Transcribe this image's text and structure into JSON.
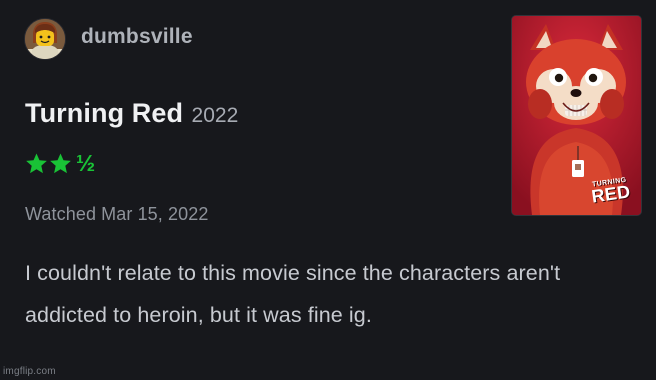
{
  "review": {
    "username": "dumbsville",
    "movie_title": "Turning Red",
    "year": "2022",
    "rating": {
      "stars": 2.5,
      "max": 5,
      "star_glyphs": "★★",
      "half_glyph": "½",
      "color": "#19c236"
    },
    "watched_date": "Watched Mar 15, 2022",
    "text": "I couldn't relate to this movie since the characters aren't addicted to heroin, but it was fine ig."
  },
  "poster": {
    "title_line1": "TURNING",
    "title_line2": "RED"
  },
  "watermark": "imgflip.com",
  "icons": {
    "avatar": "avatar-lego-minifigure-icon",
    "star": "star-icon"
  },
  "colors": {
    "background": "#17181c",
    "rating_green": "#19c236",
    "poster_red": "#b21a2b"
  }
}
